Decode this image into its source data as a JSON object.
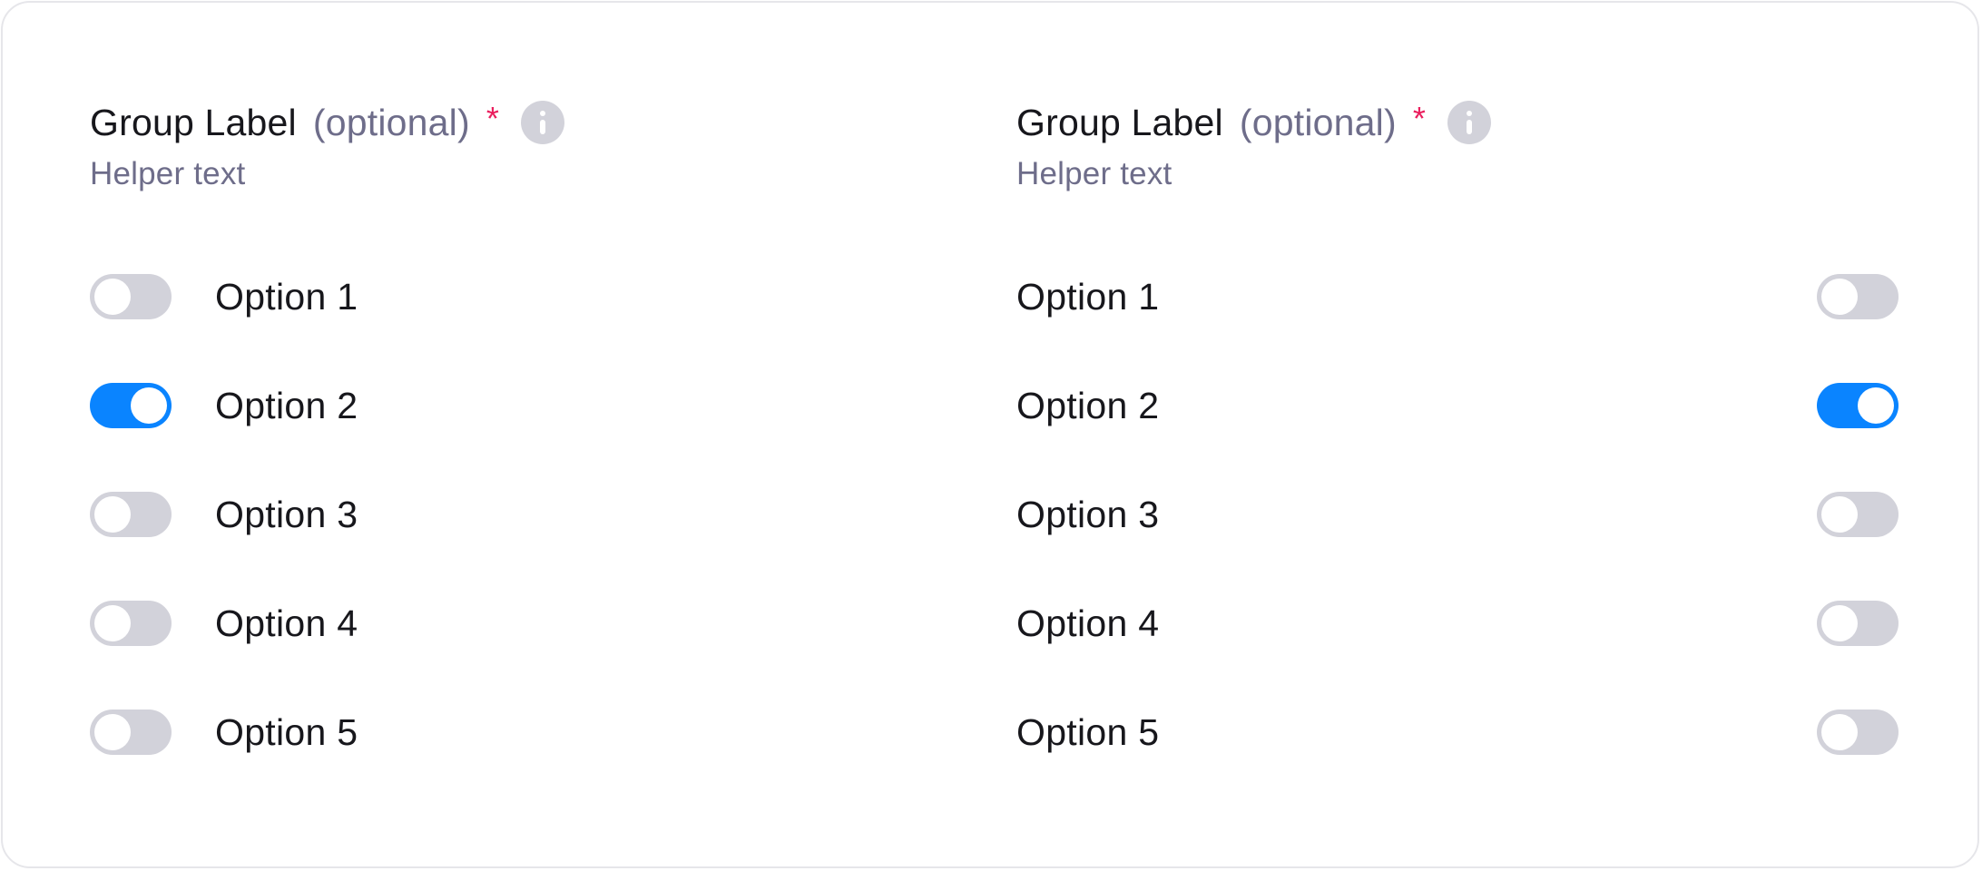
{
  "groups": [
    {
      "label": "Group Label",
      "optional": "(optional)",
      "required_mark": "*",
      "helper_text": "Helper text",
      "options": [
        {
          "label": "Option 1",
          "checked": false
        },
        {
          "label": "Option 2",
          "checked": true
        },
        {
          "label": "Option 3",
          "checked": false
        },
        {
          "label": "Option 4",
          "checked": false
        },
        {
          "label": "Option 5",
          "checked": false
        }
      ]
    },
    {
      "label": "Group Label",
      "optional": "(optional)",
      "required_mark": "*",
      "helper_text": "Helper text",
      "options": [
        {
          "label": "Option 1",
          "checked": false
        },
        {
          "label": "Option 2",
          "checked": true
        },
        {
          "label": "Option 3",
          "checked": false
        },
        {
          "label": "Option 4",
          "checked": false
        },
        {
          "label": "Option 5",
          "checked": false
        }
      ]
    }
  ],
  "colors": {
    "toggle_on": "#0a84ff",
    "toggle_off": "#d2d2da",
    "required": "#ea1e5d",
    "muted_text": "#6e6d8a",
    "text": "#17171c"
  }
}
